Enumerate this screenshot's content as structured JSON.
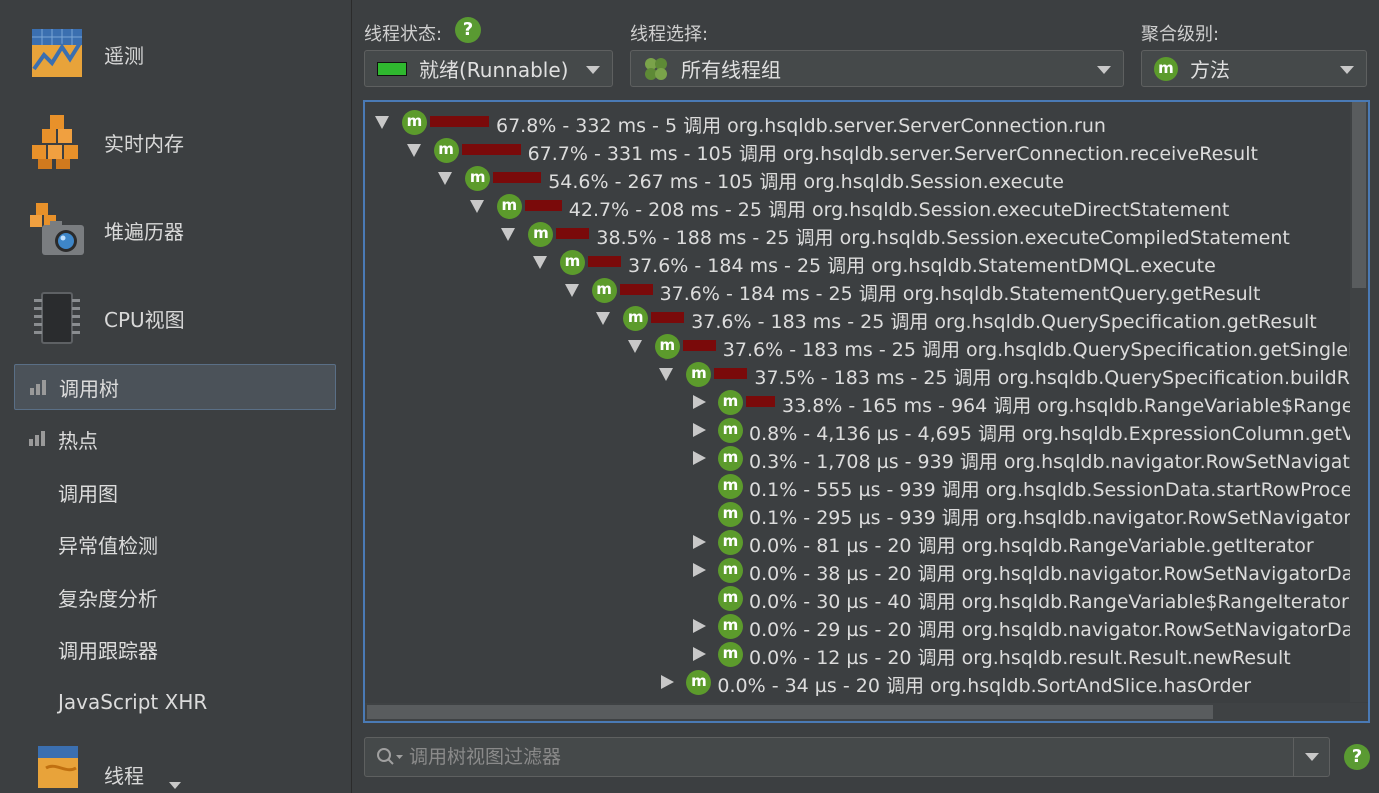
{
  "sidebar": {
    "big_items": [
      {
        "label": "遥测",
        "icon": "telemetry-icon"
      },
      {
        "label": "实时内存",
        "icon": "live-memory-icon"
      },
      {
        "label": "堆遍历器",
        "icon": "heap-walker-icon"
      },
      {
        "label": "CPU视图",
        "icon": "cpu-chip-icon"
      }
    ],
    "items": [
      {
        "label": "调用树",
        "icon": "bar-chart-icon",
        "active": true
      },
      {
        "label": "热点",
        "icon": "bar-chart-icon"
      },
      {
        "label": "调用图"
      },
      {
        "label": "异常值检测"
      },
      {
        "label": "复杂度分析"
      },
      {
        "label": "调用跟踪器"
      },
      {
        "label": "JavaScript XHR"
      }
    ],
    "bottom_item": {
      "label": "线程",
      "icon": "threads-icon"
    }
  },
  "controls": {
    "thread_state": {
      "label": "线程状态:",
      "value": "就绪(Runnable)",
      "swatch_color": "#2fb82f"
    },
    "thread_select": {
      "label": "线程选择:",
      "value": "所有线程组"
    },
    "aggregation": {
      "label": "聚合级别:",
      "value": "方法"
    },
    "help": "?"
  },
  "tree": {
    "method_badge": "m",
    "rows": [
      {
        "depth": 0,
        "toggle": "down",
        "pct_bar": 67.8,
        "text": "67.8% - 332 ms - 5 调用 org.hsqldb.server.ServerConnection.run"
      },
      {
        "depth": 1,
        "toggle": "down",
        "pct_bar": 67.7,
        "text": "67.7% - 331 ms - 105 调用 org.hsqldb.server.ServerConnection.receiveResult"
      },
      {
        "depth": 2,
        "toggle": "down",
        "pct_bar": 54.6,
        "text": "54.6% - 267 ms - 105 调用 org.hsqldb.Session.execute"
      },
      {
        "depth": 3,
        "toggle": "down",
        "pct_bar": 42.7,
        "text": "42.7% - 208 ms - 25 调用 org.hsqldb.Session.executeDirectStatement"
      },
      {
        "depth": 4,
        "toggle": "down",
        "pct_bar": 38.5,
        "text": "38.5% - 188 ms - 25 调用 org.hsqldb.Session.executeCompiledStatement"
      },
      {
        "depth": 5,
        "toggle": "down",
        "pct_bar": 37.6,
        "text": "37.6% - 184 ms - 25 调用 org.hsqldb.StatementDMQL.execute"
      },
      {
        "depth": 6,
        "toggle": "down",
        "pct_bar": 37.6,
        "text": "37.6% - 184 ms - 25 调用 org.hsqldb.StatementQuery.getResult"
      },
      {
        "depth": 7,
        "toggle": "down",
        "pct_bar": 37.6,
        "text": "37.6% - 183 ms - 25 调用 org.hsqldb.QuerySpecification.getResult"
      },
      {
        "depth": 8,
        "toggle": "down",
        "pct_bar": 37.6,
        "text": "37.6% - 183 ms - 25 调用 org.hsqldb.QuerySpecification.getSingleResult"
      },
      {
        "depth": 9,
        "toggle": "down",
        "pct_bar": 37.5,
        "text": "37.5% - 183 ms - 25 调用 org.hsqldb.QuerySpecification.buildResult"
      },
      {
        "depth": 10,
        "toggle": "right",
        "pct_bar": 33.8,
        "text": "33.8% - 165 ms - 964 调用 org.hsqldb.RangeVariable$RangeIteratorMain"
      },
      {
        "depth": 10,
        "toggle": "right",
        "pct_bar": 0,
        "text": "0.8% - 4,136 µs - 4,695 调用 org.hsqldb.ExpressionColumn.getValue"
      },
      {
        "depth": 10,
        "toggle": "right",
        "pct_bar": 0,
        "text": "0.3% - 1,708 µs - 939 调用 org.hsqldb.navigator.RowSetNavigator"
      },
      {
        "depth": 10,
        "toggle": "none",
        "pct_bar": 0,
        "text": "0.1% - 555 µs - 939 调用 org.hsqldb.SessionData.startRowProcessing"
      },
      {
        "depth": 10,
        "toggle": "none",
        "pct_bar": 0,
        "text": "0.1% - 295 µs - 939 调用 org.hsqldb.navigator.RowSetNavigator.getSize"
      },
      {
        "depth": 10,
        "toggle": "right",
        "pct_bar": 0,
        "text": "0.0% - 81 µs - 20 调用 org.hsqldb.RangeVariable.getIterator"
      },
      {
        "depth": 10,
        "toggle": "right",
        "pct_bar": 0,
        "text": "0.0% - 38 µs - 20 调用 org.hsqldb.navigator.RowSetNavigatorData"
      },
      {
        "depth": 10,
        "toggle": "none",
        "pct_bar": 0,
        "text": "0.0% - 30 µs - 40 调用 org.hsqldb.RangeVariable$RangeIteratorMain"
      },
      {
        "depth": 10,
        "toggle": "right",
        "pct_bar": 0,
        "text": "0.0% - 29 µs - 20 调用 org.hsqldb.navigator.RowSetNavigatorData"
      },
      {
        "depth": 10,
        "toggle": "right",
        "pct_bar": 0,
        "text": "0.0% - 12 µs - 20 调用 org.hsqldb.result.Result.newResult"
      },
      {
        "depth": 9,
        "toggle": "right",
        "pct_bar": 0,
        "text": "0.0% - 34 µs - 20 调用 org.hsqldb.SortAndSlice.hasOrder"
      }
    ]
  },
  "filter": {
    "placeholder": "调用树视图过滤器"
  }
}
